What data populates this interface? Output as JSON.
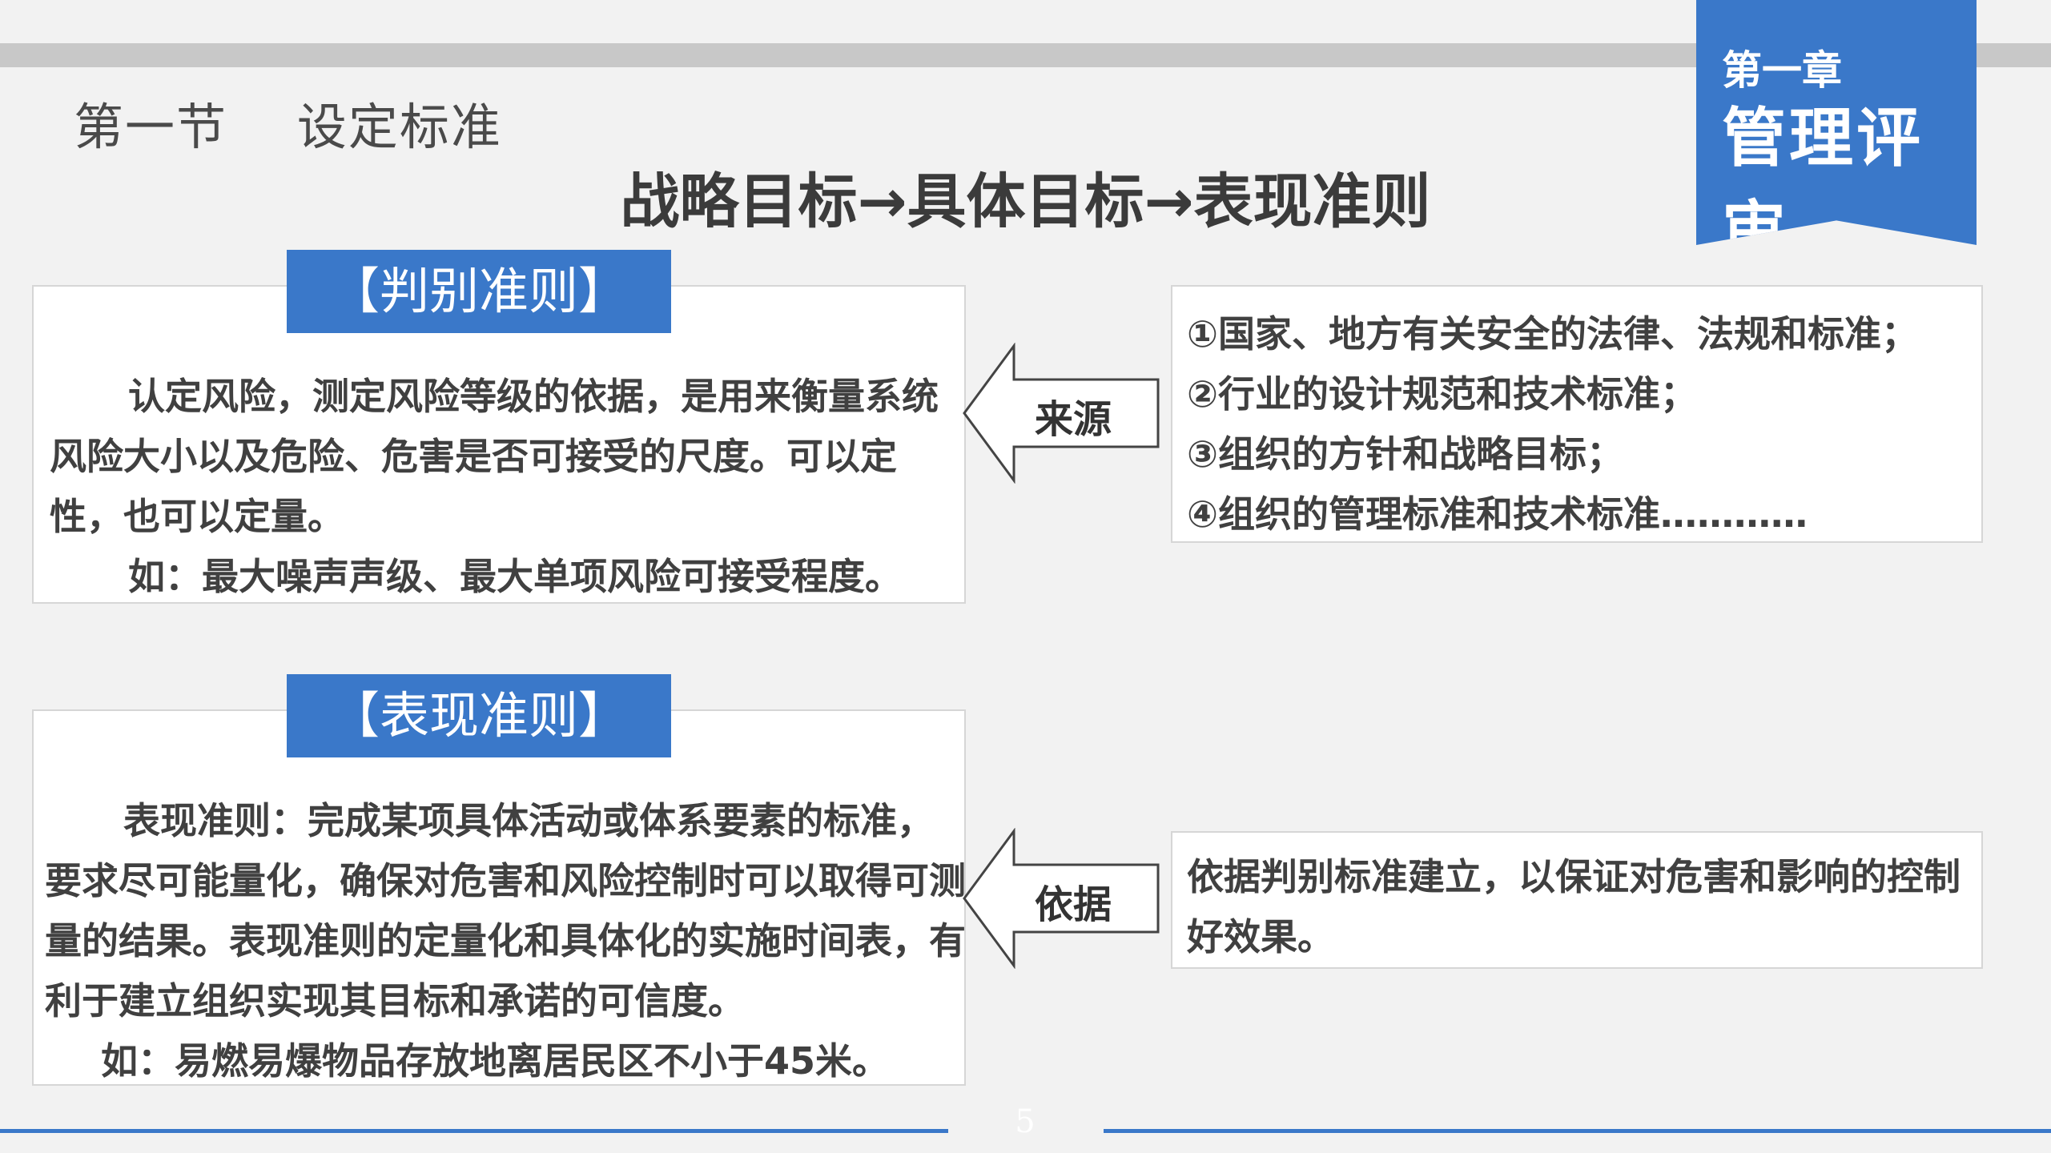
{
  "section_title": "第一节    设定标准",
  "chapter": {
    "label_small": "第一章",
    "label_big": "管理评审"
  },
  "main_title": "战略目标→具体目标→表现准则",
  "criteria_panel": {
    "tab": "【判别准则】",
    "paragraph": "认定风险，测定风险等级的依据，是用来衡量系统风险大小以及危险、危害是否可接受的尺度。可以定性，也可以定量。",
    "example": "如：最大噪声声级、最大单项风险可接受程度。"
  },
  "performance_panel": {
    "tab": "【表现准则】",
    "paragraph": "表现准则：完成某项具体活动或体系要素的标准，要求尽可能量化，确保对危害和风险控制时可以取得可测量的结果。表现准则的定量化和具体化的实施时间表，有利于建立组织实现其目标和承诺的可信度。",
    "example": "如：易燃易爆物品存放地离居民区不小于45米。"
  },
  "arrow_source": {
    "label": "来源"
  },
  "arrow_basis": {
    "label": "依据"
  },
  "sources_box": {
    "items": [
      "①国家、地方有关安全的法律、法规和标准；",
      "②行业的设计规范和技术标准；",
      "③组织的方针和战略目标；",
      "④组织的管理标准和技术标准…………"
    ]
  },
  "basis_box": {
    "text": "依据判别标准建立，以保证对危害和影响的控制好效果。"
  },
  "page_number": "5",
  "colors": {
    "accent": "#3a78c9",
    "background": "#f2f2f2",
    "bar": "#c8c8c8"
  }
}
